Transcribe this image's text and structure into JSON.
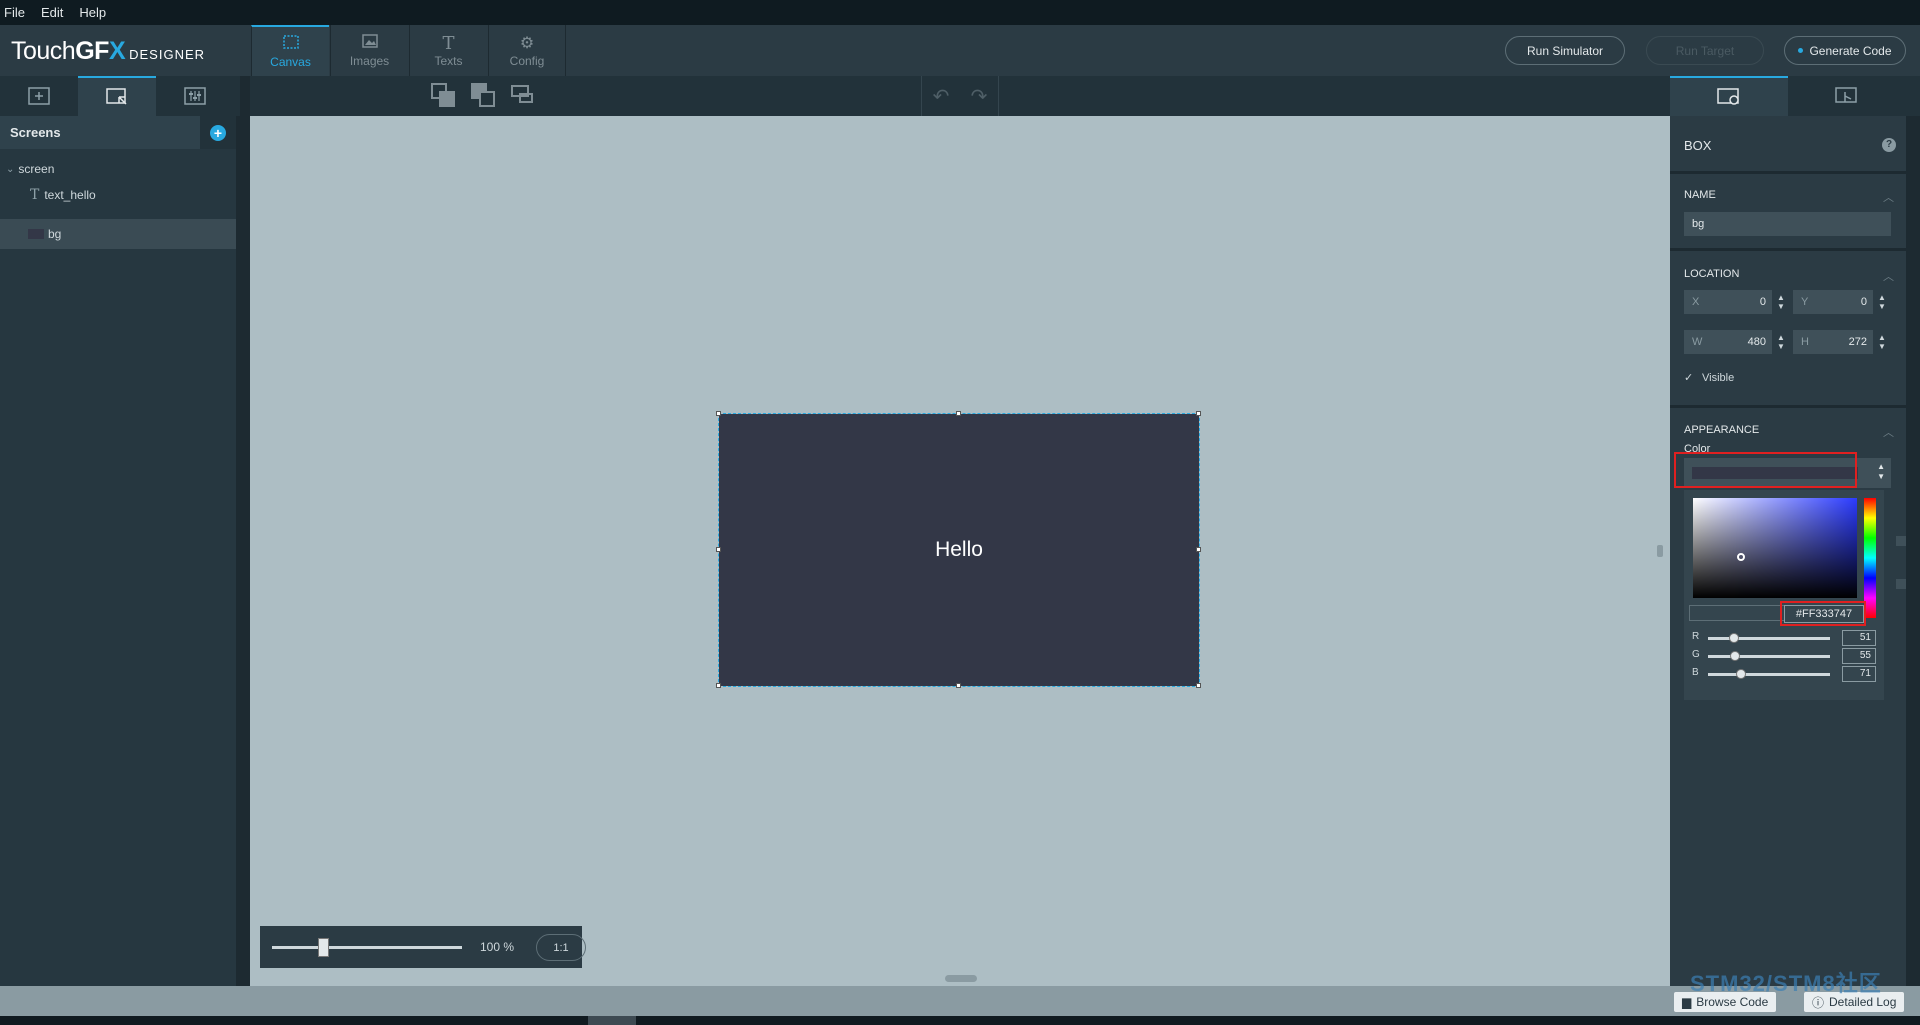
{
  "menu": {
    "file": "File",
    "edit": "Edit",
    "help": "Help"
  },
  "logo": {
    "part1": "Touch",
    "part2": "GF",
    "part3": "X",
    "part4": "DESIGNER"
  },
  "nav_tabs": [
    {
      "label": "Canvas",
      "icon": "canvas-icon"
    },
    {
      "label": "Images",
      "icon": "images-icon"
    },
    {
      "label": "Texts",
      "icon": "texts-icon"
    },
    {
      "label": "Config",
      "icon": "gear-icon"
    }
  ],
  "header_buttons": {
    "run_simulator": "Run Simulator",
    "run_target": "Run Target",
    "generate_code": "Generate Code"
  },
  "left_panel": {
    "title": "Screens",
    "tree": [
      {
        "label": "screen"
      },
      {
        "label": "text_hello"
      },
      {
        "label": "bg"
      }
    ]
  },
  "canvas": {
    "text": "Hello",
    "box_color": "#333747",
    "background_color": "#adbec4",
    "zoom_label": "100 %",
    "zoom_reset": "1:1"
  },
  "properties": {
    "widget_type": "BOX",
    "name_section": "NAME",
    "name_value": "bg",
    "location_section": "LOCATION",
    "x_label": "X",
    "x_value": "0",
    "y_label": "Y",
    "y_value": "0",
    "w_label": "W",
    "w_value": "480",
    "h_label": "H",
    "h_value": "272",
    "visible_label": "Visible",
    "visible_checked": true,
    "appearance_section": "APPEARANCE",
    "color_label": "Color",
    "hex": "#FF333747",
    "r_label": "R",
    "r_value": "51",
    "g_label": "G",
    "g_value": "55",
    "b_label": "B",
    "b_value": "71"
  },
  "statusbar": {
    "browse_code": "Browse Code",
    "detailed_log": "Detailed Log"
  },
  "watermark": "STM32/STM8社区"
}
